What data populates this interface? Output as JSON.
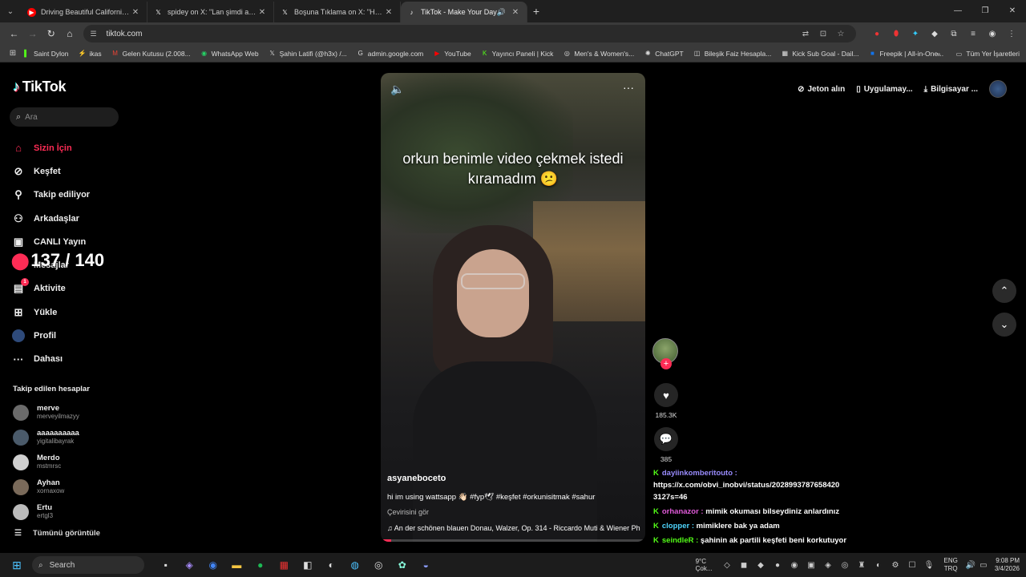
{
  "browser": {
    "tabs": [
      {
        "title": "Driving Beautiful California Sa",
        "icon": "youtube-icon"
      },
      {
        "title": "spidey on X: \"Lan şimdi anladım",
        "icon": "x-icon"
      },
      {
        "title": "Boşuna Tıklama on X: \"Hız sınırı",
        "icon": "x-icon"
      },
      {
        "title": "TikTok - Make Your Day",
        "icon": "tiktok-icon",
        "active": true
      }
    ],
    "url": "tiktok.com",
    "bookmarks": [
      "Saint Dylon",
      "ikas",
      "Gelen Kutusu (2.008...",
      "WhatsApp Web",
      "Şahin Latifi (@h3x) /...",
      "admin.google.com",
      "YouTube",
      "Yayıncı Paneli | Kick",
      "Men's & Women's...",
      "ChatGPT",
      "Bileşik Faiz Hesapla...",
      "Kick Sub Goal - Dail...",
      "Freepik | All-in-One..."
    ],
    "all_bookmarks": "Tüm Yer İşaretleri"
  },
  "sidebar": {
    "logo": "TikTok",
    "search_placeholder": "Ara",
    "nav": [
      {
        "label": "Sizin İçin",
        "icon": "home-icon",
        "active": true
      },
      {
        "label": "Keşfet",
        "icon": "compass-icon"
      },
      {
        "label": "Takip ediliyor",
        "icon": "user-add-icon"
      },
      {
        "label": "Arkadaşlar",
        "icon": "friends-icon"
      },
      {
        "label": "CANLI Yayın",
        "icon": "live-icon"
      },
      {
        "label": "Mesajlar",
        "icon": "message-icon"
      },
      {
        "label": "Aktivite",
        "icon": "activity-icon",
        "badge": "1"
      },
      {
        "label": "Yükle",
        "icon": "upload-icon"
      },
      {
        "label": "Profil",
        "icon": "profile-icon"
      },
      {
        "label": "Dahası",
        "icon": "more-icon"
      }
    ],
    "overlay_counter": "137 / 140",
    "following_title": "Takip edilen hesaplar",
    "following": [
      {
        "name": "merve",
        "handle": "merveyilmazyy"
      },
      {
        "name": "aaaaaaaaaa",
        "handle": "yigitalibayrak"
      },
      {
        "name": "Merdo",
        "handle": "mstmrsc"
      },
      {
        "name": "Ayhan",
        "handle": "xornaxow"
      },
      {
        "name": "Ertu",
        "handle": "ertgl3"
      }
    ],
    "see_all": "Tümünü görüntüle"
  },
  "video": {
    "caption": "orkun benimle video çekmek istedi kıramadım 😕",
    "username": "asyaneboceto",
    "description": "hi im using wattsapp 👋🏻 #fyp🕊 #keşfet #orkunisitmak #sahur",
    "translate": "Çevirisini gör",
    "music": "An der schönen blauen Donau, Walzer, Op. 314 - Riccardo Muti & Wiener Philharmoniker",
    "progress": 0.04
  },
  "actions": {
    "likes": "185.3K",
    "comments": "385"
  },
  "top_right": {
    "coins": "Jeton alın",
    "app": "Uygulamay...",
    "desktop": "Bilgisayar ..."
  },
  "chat": [
    {
      "user": "dayiinkomberitouto :",
      "text": "https://x.com/obvi_inobvi/status/2028993787658420 3127s=46"
    },
    {
      "user": "orhanazor :",
      "text": "mimik okuması bilseydiniz anlardınız"
    },
    {
      "user": "clopper :",
      "text": "mimiklere bak ya adam"
    },
    {
      "user": "seindleR :",
      "text": "şahinin ak partili keşfeti beni korkutuyor"
    }
  ],
  "taskbar": {
    "search": "Search",
    "weather_temp": "9°C",
    "weather_desc": "Çok...",
    "lang_top": "ENG",
    "lang_bottom": "TRQ",
    "time": "9:08 PM",
    "date": "3/4/2026"
  }
}
